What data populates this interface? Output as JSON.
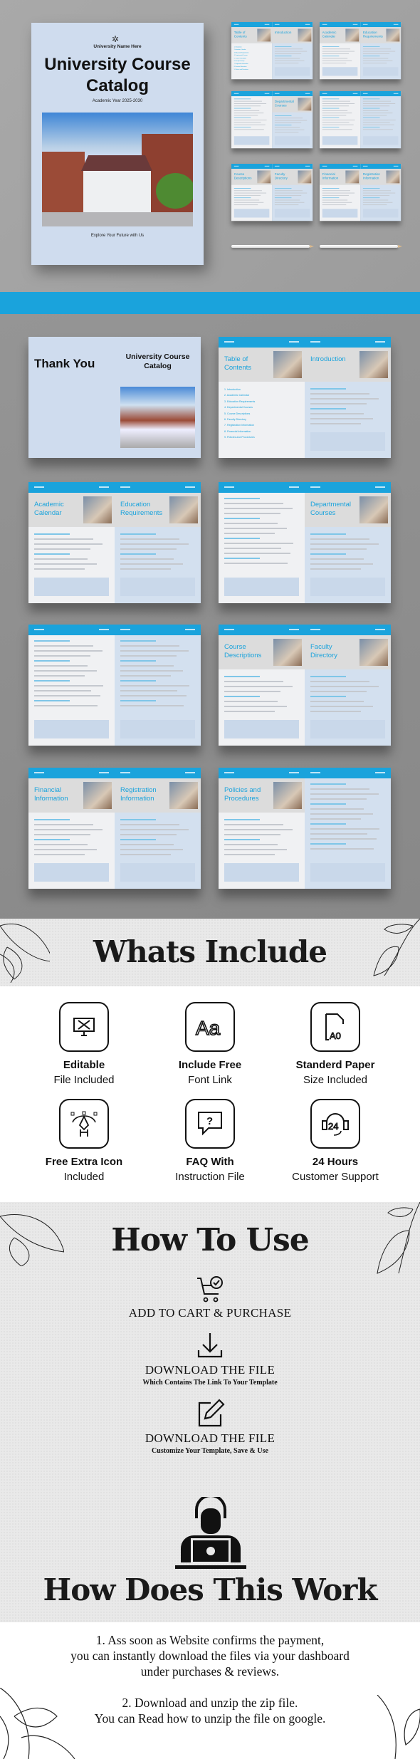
{
  "cover": {
    "university_name": "University Name Here",
    "title": "University Course Catalog",
    "academic_year": "Academic Year 2025-2030",
    "tagline": "Explore Your Future with Us"
  },
  "spreads": [
    {
      "left": {
        "big": "Thank You"
      },
      "right": {
        "cover": "University Course Catalog"
      }
    },
    {
      "left": {
        "title": "Table of Contents",
        "toc": [
          "1. Introduction",
          "2. Academic Calendar",
          "3. Education Requirements",
          "4. Departmental Courses",
          "5. Course Descriptions",
          "6. Faculty Directory",
          "7. Registration Information",
          "8. Financial Information",
          "9. Policies and Procedures"
        ]
      },
      "right": {
        "title": "Introduction"
      }
    },
    {
      "left": {
        "title": "Academic Calendar"
      },
      "right": {
        "title": "Education Requirements"
      }
    },
    {
      "left": {},
      "right": {
        "title": "Departmental Courses"
      }
    },
    {
      "left": {},
      "right": {}
    },
    {
      "left": {
        "title": "Course Descriptions"
      },
      "right": {
        "title": "Faculty Directory"
      }
    },
    {
      "left": {
        "title": "Financial Information"
      },
      "right": {
        "title": "Registration Information"
      }
    },
    {
      "left": {
        "title": "Policies and Procedures"
      },
      "right": {}
    }
  ],
  "whats_include": {
    "title": "Whats Include",
    "items": [
      {
        "icon": "editable-monitor-icon",
        "bold": "Editable",
        "text": "File Included"
      },
      {
        "icon": "font-aa-icon",
        "bold": "Include Free",
        "text": "Font Link"
      },
      {
        "icon": "paper-a0-icon",
        "bold": "Standerd Paper",
        "text": "Size Included"
      },
      {
        "icon": "pen-tool-icon",
        "bold": "Free Extra Icon",
        "text": "Included"
      },
      {
        "icon": "faq-chat-icon",
        "bold": "FAQ With",
        "text": "Instruction File"
      },
      {
        "icon": "support-24-icon",
        "bold": "24 Hours",
        "text": "Customer Support"
      }
    ]
  },
  "how_to_use": {
    "title": "How To Use",
    "steps": [
      {
        "icon": "cart-check-icon",
        "heading": "ADD TO CART & PURCHASE",
        "sub": ""
      },
      {
        "icon": "download-icon",
        "heading": "DOWNLOAD THE FILE",
        "sub": "Which Contains The Link To Your Template"
      },
      {
        "icon": "edit-icon",
        "heading": "DOWNLOAD THE FILE",
        "sub": "Customize Your Template, Save & Use"
      }
    ]
  },
  "how_does_this_work": {
    "title": "How Does This Work",
    "para1": [
      "1. Ass soon as Website confirms the payment,",
      "you can instantly download the files via your dashboard",
      "under purchases & reviews."
    ],
    "para2": [
      "2. Download and unzip the zip file.",
      "You can Read how to unzip the file on google."
    ]
  },
  "colors": {
    "accent": "#1aa3dc",
    "cover_bg": "#cfdcee",
    "text": "#111111"
  }
}
